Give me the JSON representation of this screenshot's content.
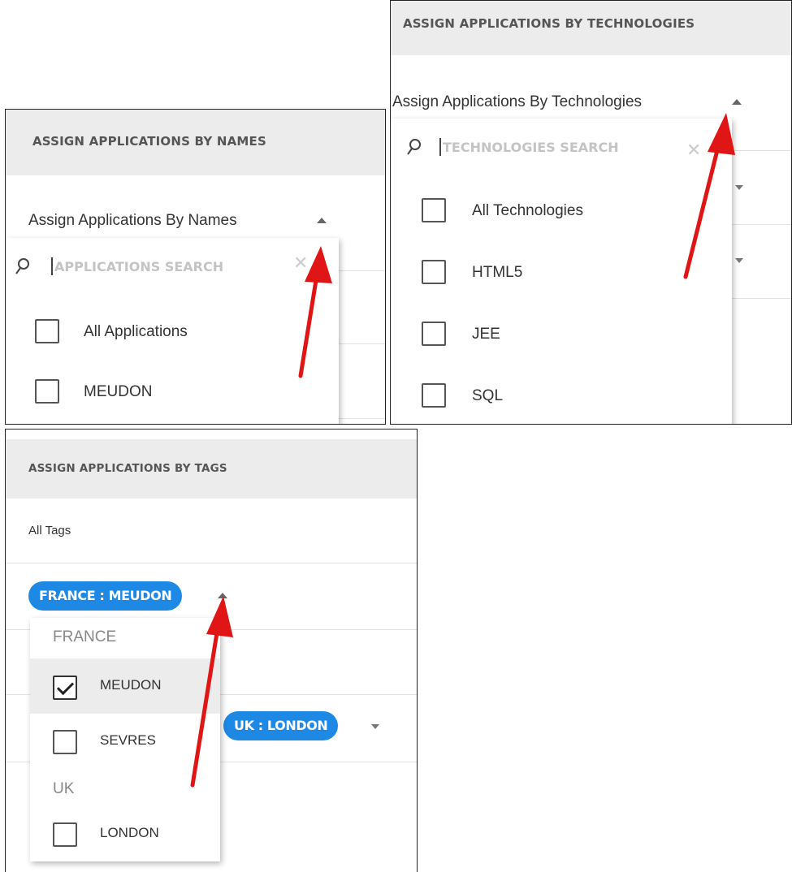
{
  "names_panel": {
    "header": "ASSIGN APPLICATIONS BY NAMES",
    "select_label": "Assign Applications By Names",
    "search_placeholder": "APPLICATIONS SEARCH",
    "options": [
      {
        "label": "All Applications",
        "checked": false
      },
      {
        "label": "MEUDON",
        "checked": false
      }
    ]
  },
  "technologies_panel": {
    "header": "ASSIGN APPLICATIONS BY TECHNOLOGIES",
    "select_label": "Assign Applications By Technologies",
    "search_placeholder": "TECHNOLOGIES SEARCH",
    "options": [
      {
        "label": "All Technologies",
        "checked": false
      },
      {
        "label": "HTML5",
        "checked": false
      },
      {
        "label": "JEE",
        "checked": false
      },
      {
        "label": "SQL",
        "checked": false
      }
    ]
  },
  "tags_panel": {
    "header": "ASSIGN APPLICATIONS BY TAGS",
    "all_tags_label": "All Tags",
    "selected_tag": "FRANCE : MEUDON",
    "second_tag": "UK : LONDON",
    "groups": [
      {
        "name": "FRANCE",
        "options": [
          {
            "label": "MEUDON",
            "checked": true
          },
          {
            "label": "SEVRES",
            "checked": false
          }
        ]
      },
      {
        "name": "UK",
        "options": [
          {
            "label": "LONDON",
            "checked": false
          }
        ]
      }
    ]
  },
  "colors": {
    "accent_blue": "#1e88e5",
    "header_bg": "#ececec",
    "annotation_arrow": "#e01515"
  },
  "icons": [
    "search-icon",
    "clear-icon",
    "caret-up-icon",
    "caret-down-icon",
    "checkbox-icon",
    "annotation-arrow-icon"
  ]
}
